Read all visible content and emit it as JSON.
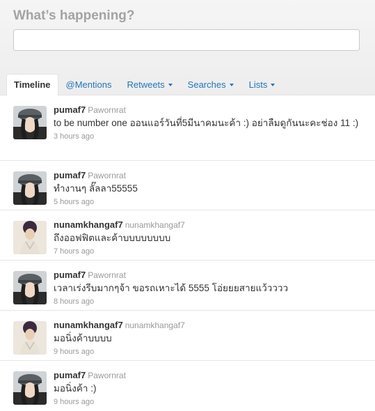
{
  "compose": {
    "prompt": "What’s happening?",
    "value": ""
  },
  "tabs": [
    {
      "label": "Timeline",
      "active": true
    },
    {
      "label": "@Mentions"
    },
    {
      "label": "Retweets"
    },
    {
      "label": "Searches"
    },
    {
      "label": "Lists"
    }
  ],
  "tweets": [
    {
      "screen_name": "pumaf7",
      "full_name": "Pawornrat",
      "text": "to be number one ออนแอร์วันที่5มีนาคมนะค้า :) อย่าลืมดูกันนะคะช่อง 11 :)",
      "time": "3 hours ago"
    },
    {
      "screen_name": "pumaf7",
      "full_name": "Pawornrat",
      "text": "ทำงานๆ ลั๊ลลา55555",
      "time": "5 hours ago"
    },
    {
      "screen_name": "nunamkhangaf7",
      "full_name": "nunamkhangaf7",
      "text": "ถึงออฟฟิตและค้าบบบบบบบบ",
      "time": "7 hours ago"
    },
    {
      "screen_name": "pumaf7",
      "full_name": "Pawornrat",
      "text": "เวลาเร่งรีบมากๆจ้า ขอรถเหาะได้ 5555 โอ่ยยยสายแว้วววว",
      "time": "8 hours ago"
    },
    {
      "screen_name": "nunamkhangaf7",
      "full_name": "nunamkhangaf7",
      "text": "มอนิ่งค้าบบบบ",
      "time": "9 hours ago"
    },
    {
      "screen_name": "pumaf7",
      "full_name": "Pawornrat",
      "text": "มอนิ่งค้า :)",
      "time": "9 hours ago"
    }
  ]
}
